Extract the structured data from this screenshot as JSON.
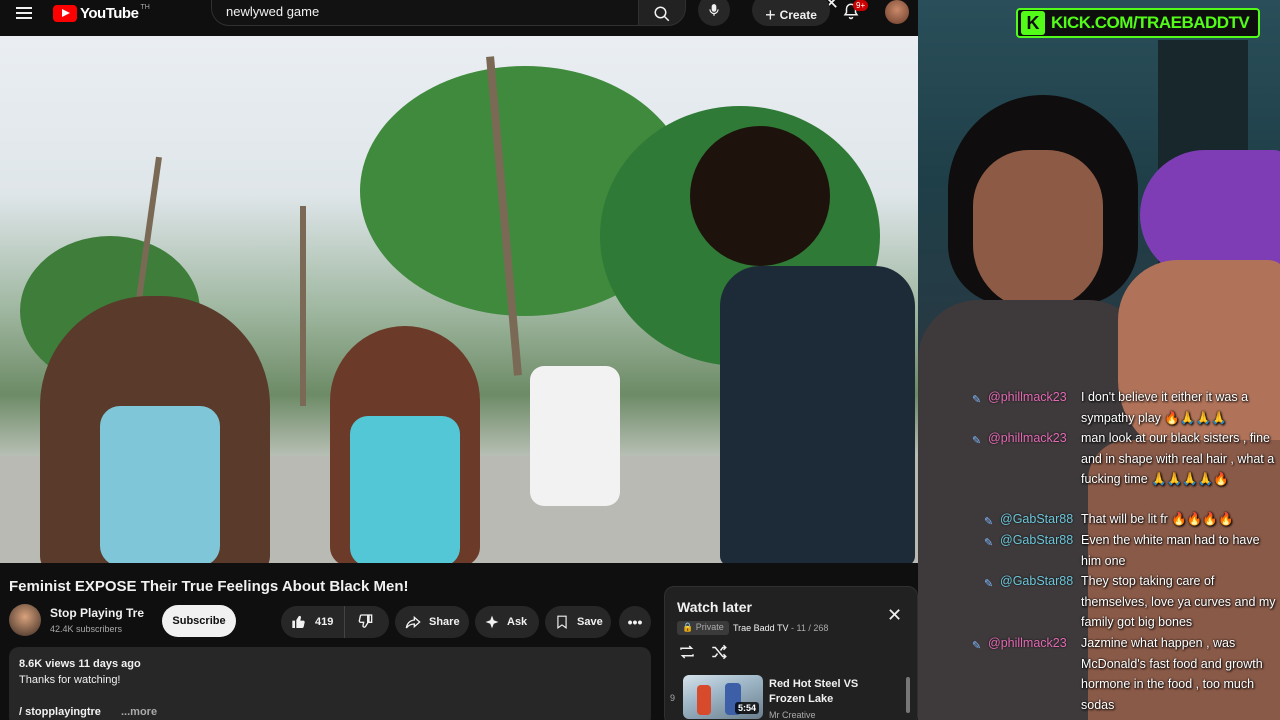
{
  "topbar": {
    "logo_text": "YouTube",
    "logo_country": "TH",
    "search_value": "newlywed game",
    "create_label": "Create",
    "notification_count": "9+"
  },
  "video": {
    "title": "Feminist EXPOSE Their True Feelings About Black Men!",
    "channel": {
      "name": "Stop Playing Tre",
      "subscribers": "42.4K subscribers"
    },
    "subscribe_label": "Subscribe",
    "actions": {
      "likes": "419",
      "share": "Share",
      "ask": "Ask",
      "save": "Save"
    },
    "description": {
      "meta": "8.6K views  11 days ago",
      "text": "Thanks for watching!",
      "link": "/ stopplayingtre",
      "more": "...more"
    }
  },
  "watch_later": {
    "title": "Watch later",
    "privacy": "Private",
    "owner": "Trae Badd TV",
    "position": "11 / 268",
    "item": {
      "index": "9",
      "title": "Red Hot Steel VS Frozen Lake",
      "channel": "Mr Creative",
      "duration": "5:54"
    }
  },
  "stream": {
    "kick_url": "KICK.COM/TRAEBADDTV",
    "chat": [
      {
        "user": "@phillmack23",
        "color": "pink",
        "text": "I don't believe it either it was a sympathy play 🔥🙏🙏🙏"
      },
      {
        "user": "@phillmack23",
        "color": "pink",
        "text": "man look at our black sisters , fine and in shape with real hair , what a fucking time 🙏🙏🙏🙏🔥"
      },
      {
        "user": "@GabStar88",
        "color": "teal",
        "text": "That will be lit fr 🔥🔥🔥🔥"
      },
      {
        "user": "@GabStar88",
        "color": "teal",
        "text": "Even the white man had to have him one"
      },
      {
        "user": "@GabStar88",
        "color": "teal",
        "text": "They stop taking care of themselves, love ya curves and my family got big bones"
      },
      {
        "user": "@phillmack23",
        "color": "pink",
        "text": "Jazmine what happen , was McDonald's fast food and growth hormone in the food , too much sodas"
      }
    ]
  }
}
